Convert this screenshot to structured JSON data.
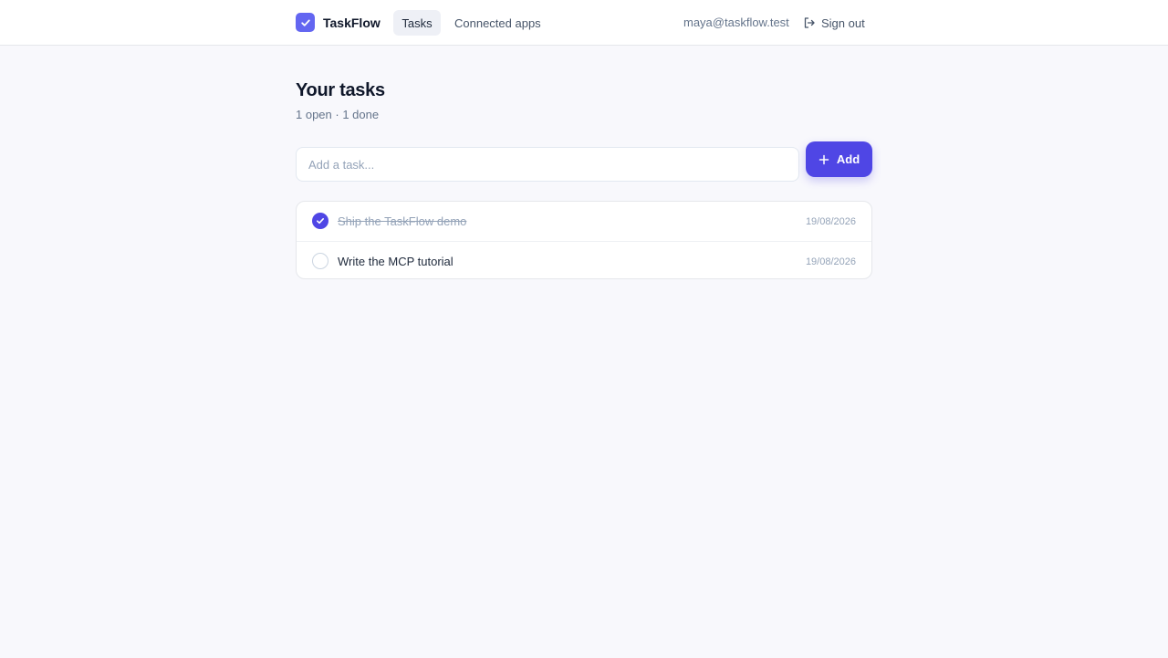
{
  "header": {
    "brand": "TaskFlow",
    "nav": [
      {
        "label": "Tasks",
        "active": true
      },
      {
        "label": "Connected apps",
        "active": false
      }
    ],
    "user_email": "maya@taskflow.test",
    "signout_label": "Sign out"
  },
  "main": {
    "title": "Your tasks",
    "summary": "1 open · 1 done",
    "input_placeholder": "Add a task...",
    "add_label": "Add",
    "tasks": [
      {
        "text": "Ship the TaskFlow demo",
        "date": "19/08/2026",
        "done": true
      },
      {
        "text": "Write the MCP tutorial",
        "date": "19/08/2026",
        "done": false
      }
    ]
  },
  "colors": {
    "accent": "#4f46e5",
    "brand_logo": "#6366f1",
    "background": "#f8f8fc"
  },
  "icons": [
    "check-icon",
    "plus-icon",
    "sign-out-icon"
  ]
}
